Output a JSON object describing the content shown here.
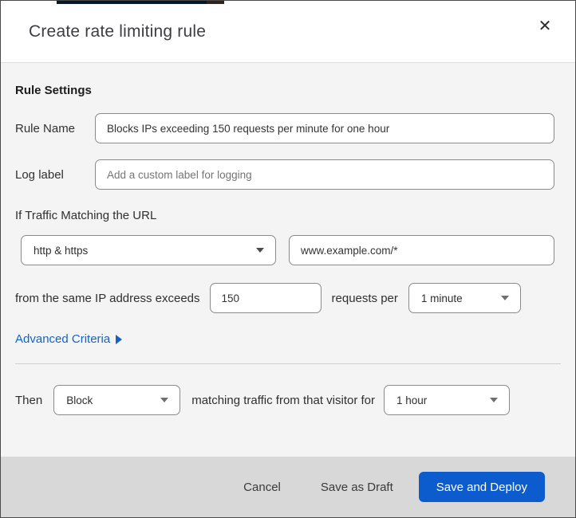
{
  "dialog": {
    "title": "Create rate limiting rule",
    "close_glyph": "✕"
  },
  "rule_settings": {
    "heading": "Rule Settings",
    "rule_name": {
      "label": "Rule Name",
      "value": "Blocks IPs exceeding 150 requests per minute for one hour"
    },
    "log_label": {
      "label": "Log label",
      "placeholder": "Add a custom label for logging"
    }
  },
  "match": {
    "intro": "If Traffic Matching the URL",
    "scheme_select": {
      "value": "http & https"
    },
    "url_input": {
      "value": "www.example.com/*"
    },
    "threshold_prefix": "from the same IP address exceeds",
    "threshold_value": "150",
    "threshold_suffix": "requests per",
    "period_select": {
      "value": "1 minute"
    },
    "advanced_link": "Advanced Criteria"
  },
  "action": {
    "then_label": "Then",
    "action_select": {
      "value": "Block"
    },
    "middle_text": "matching traffic from that visitor for",
    "duration_select": {
      "value": "1 hour"
    }
  },
  "footer": {
    "cancel_label": "Cancel",
    "save_draft_label": "Save as Draft",
    "save_deploy_label": "Save and Deploy"
  },
  "colors": {
    "primary_button": "#0d5ccd",
    "link_blue": "#1463c4",
    "body_bg": "#f4f4f5",
    "footer_bg": "#d8d8d9",
    "input_border": "#8a8a8a"
  }
}
